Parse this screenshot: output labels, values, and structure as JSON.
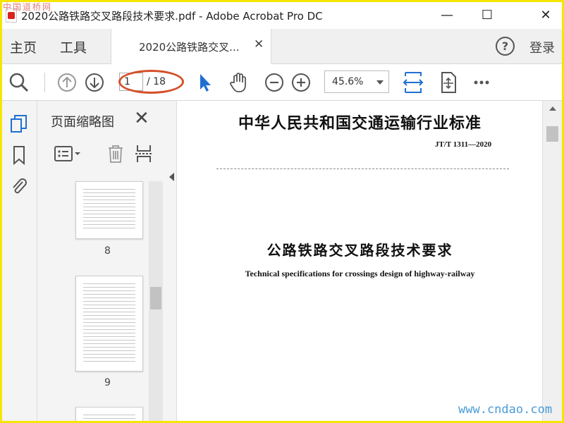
{
  "window": {
    "title": "2020公路铁路交叉路段技术要求.pdf - Adobe Acrobat Pro DC",
    "minimize_icon": "minimize-icon",
    "maximize_icon": "maximize-icon",
    "close_icon": "close-icon"
  },
  "menubar": {
    "home": "主页",
    "tools": "工具",
    "doc_tab": "2020公路铁路交叉...",
    "help": "?",
    "login": "登录"
  },
  "toolbar": {
    "current_page": "1",
    "total_pages": "/ 18",
    "zoom": "45.6%",
    "icons": [
      "search-icon",
      "page-up-icon",
      "page-down-icon",
      "select-cursor-icon",
      "hand-icon",
      "zoom-out-icon",
      "zoom-in-icon",
      "fit-width-icon",
      "fit-page-icon",
      "more-icon"
    ],
    "highlight_color": "#d4502a",
    "accent_color": "#1f6fd1"
  },
  "sidebar": {
    "panel_title": "页面缩略图",
    "thumbnails": [
      {
        "label": "8"
      },
      {
        "label": "9"
      }
    ]
  },
  "document": {
    "heading": "中华人民共和国交通运输行业标准",
    "code": "JT/T 1311—2020",
    "title": "公路铁路交叉路段技术要求",
    "subtitle": "Technical specifications for crossings design of highway-railway"
  },
  "watermarks": {
    "top": "中国道桥网",
    "bottom": "www.cndao.com"
  }
}
